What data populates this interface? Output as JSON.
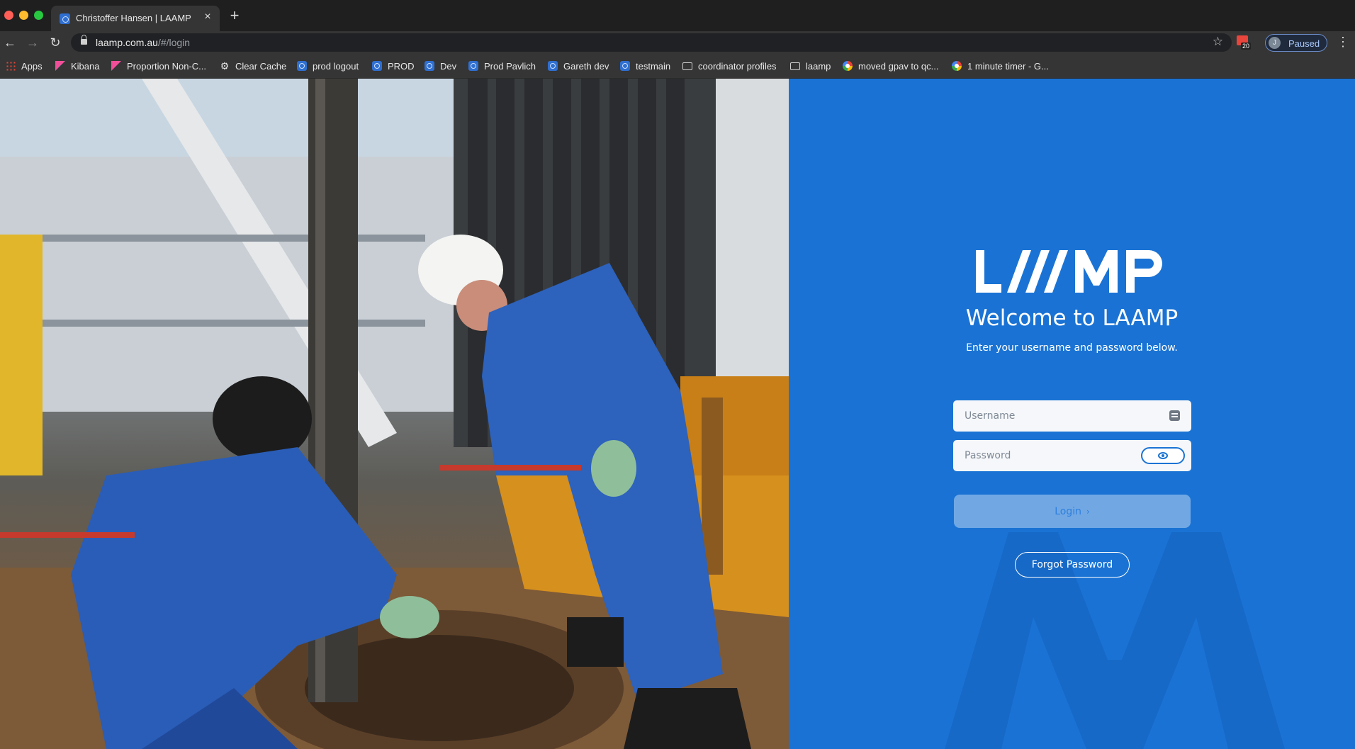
{
  "browser": {
    "tab_title": "Christoffer Hansen | LAAMP",
    "tab_close": "×",
    "new_tab": "+",
    "url_host": "laamp.com.au",
    "url_path": "/#/login",
    "profile_initial": "J",
    "profile_status": "Paused",
    "extension_badge": "20",
    "bookmarks": [
      {
        "label": "Apps",
        "icon": "apps-grid-icon"
      },
      {
        "label": "Kibana",
        "icon": "kibana-icon"
      },
      {
        "label": "Proportion Non-C...",
        "icon": "kibana-icon"
      },
      {
        "label": "Clear Cache",
        "icon": "gear-icon"
      },
      {
        "label": "prod logout",
        "icon": "laamp-favicon-icon"
      },
      {
        "label": "PROD",
        "icon": "laamp-favicon-icon"
      },
      {
        "label": "Dev",
        "icon": "laamp-favicon-icon"
      },
      {
        "label": "Prod Pavlich",
        "icon": "laamp-favicon-icon"
      },
      {
        "label": "Gareth dev",
        "icon": "laamp-favicon-icon"
      },
      {
        "label": "testmain",
        "icon": "laamp-favicon-icon"
      },
      {
        "label": "coordinator profiles",
        "icon": "folder-icon"
      },
      {
        "label": "laamp",
        "icon": "folder-icon"
      },
      {
        "label": "moved gpav to qc...",
        "icon": "google-icon"
      },
      {
        "label": "1 minute timer - G...",
        "icon": "google-icon"
      }
    ]
  },
  "login": {
    "brand": "LAAMP",
    "welcome": "Welcome to LAAMP",
    "subtitle": "Enter your username and password below.",
    "username_placeholder": "Username",
    "password_placeholder": "Password",
    "login_label": "Login",
    "login_chevron": "›",
    "forgot_label": "Forgot Password"
  },
  "colors": {
    "panel_blue": "#1a73d4",
    "login_text": "#2e7fdc"
  }
}
